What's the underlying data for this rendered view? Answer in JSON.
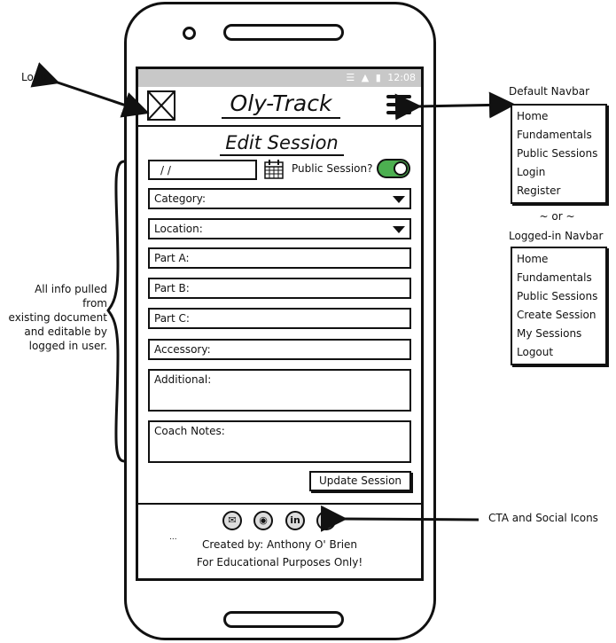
{
  "status_bar": {
    "wifi_icon": "wifi-icon",
    "signal_icon": "signal-icon",
    "battery_icon": "battery-icon",
    "time": "12:08"
  },
  "header": {
    "app_title": "Oly-Track",
    "logo_icon": "image-placeholder-icon",
    "menu_icon": "hamburger-icon"
  },
  "page": {
    "title": "Edit Session"
  },
  "form": {
    "date_value": "/ /",
    "calendar_icon": "calendar-icon",
    "public_label": "Public Session?",
    "public_toggle_on": true,
    "category_label": "Category:",
    "location_label": "Location:",
    "part_a": "Part A:",
    "part_b": "Part B:",
    "part_c": "Part C:",
    "accessory": "Accessory:",
    "additional": "Additional:",
    "coach_notes": "Coach Notes:",
    "submit_label": "Update Session"
  },
  "footer": {
    "social_icons": [
      "email-icon",
      "github-icon",
      "linkedin-icon",
      "instagram-icon"
    ],
    "ellipsis": "...",
    "credit_line1": "Created by: Anthony O' Brien",
    "credit_line2": "For Educational Purposes Only!"
  },
  "annotations": {
    "logo": "Logo",
    "default_navbar_title": "Default Navbar",
    "default_navbar_items": [
      "Home",
      "Fundamentals",
      "Public Sessions",
      "Login",
      "Register"
    ],
    "or": "~ or ~",
    "loggedin_navbar_title": "Logged-in Navbar",
    "loggedin_navbar_items": [
      "Home",
      "Fundamentals",
      "Public Sessions",
      "Create Session",
      "My Sessions",
      "Logout"
    ],
    "left_note_lines": [
      "All info pulled from",
      "existing document",
      "and editable by",
      "logged in user."
    ],
    "cta_note": "CTA and Social Icons"
  },
  "colors": {
    "toggle_on": "#4caf50",
    "status_bar": "#c8c8c8"
  }
}
